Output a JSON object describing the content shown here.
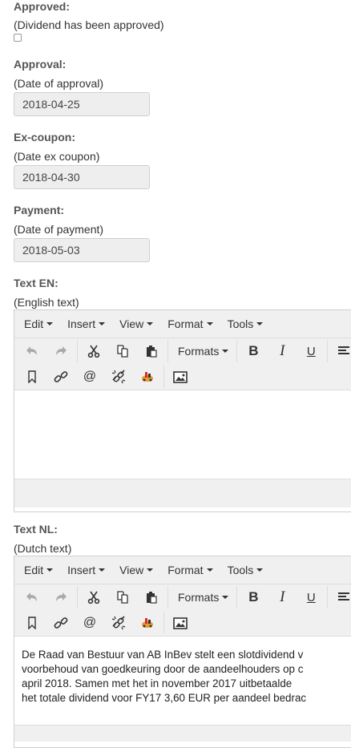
{
  "approved": {
    "label": "Approved:",
    "hint": "(Dividend has been approved)",
    "checked": false
  },
  "approval": {
    "label": "Approval:",
    "hint": "(Date of approval)",
    "value": "2018-04-25"
  },
  "ex_coupon": {
    "label": "Ex-coupon:",
    "hint": "(Date ex coupon)",
    "value": "2018-04-30"
  },
  "payment": {
    "label": "Payment:",
    "hint": "(Date of payment)",
    "value": "2018-05-03"
  },
  "menu": {
    "edit": "Edit",
    "insert": "Insert",
    "view": "View",
    "format": "Format",
    "tools": "Tools"
  },
  "toolbar": {
    "formats": "Formats",
    "icons": [
      "undo-icon",
      "redo-icon",
      "cut-icon",
      "copy-icon",
      "paste-icon",
      "bold-icon",
      "italic-icon",
      "underline-icon",
      "align-left-icon",
      "bookmark-icon",
      "link-icon",
      "email-icon",
      "unlink-icon",
      "special-icon",
      "image-icon"
    ]
  },
  "text_en": {
    "label": "Text EN:",
    "hint": "(English text)",
    "content": []
  },
  "text_nl": {
    "label": "Text NL:",
    "hint": "(Dutch text)",
    "content": [
      "De Raad van Bestuur van AB InBev stelt een slotdividend v",
      "voorbehoud van goedkeuring door de aandeelhouders op c",
      "april 2018. Samen met het in november 2017 uitbetaalde",
      "het totale dividend voor FY17 3,60 EUR per aandeel bedrac"
    ]
  }
}
